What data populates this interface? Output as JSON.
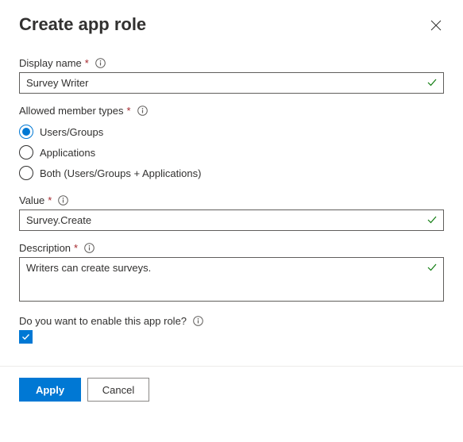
{
  "title": "Create app role",
  "fields": {
    "displayName": {
      "label": "Display name",
      "required": true,
      "value": "Survey Writer",
      "valid": true
    },
    "allowedMemberTypes": {
      "label": "Allowed member types",
      "required": true,
      "selected": "users",
      "options": [
        {
          "id": "users",
          "label": "Users/Groups"
        },
        {
          "id": "apps",
          "label": "Applications"
        },
        {
          "id": "both",
          "label": "Both (Users/Groups + Applications)"
        }
      ]
    },
    "value": {
      "label": "Value",
      "required": true,
      "value": "Survey.Create",
      "valid": true
    },
    "description": {
      "label": "Description",
      "required": true,
      "value": "Writers can create surveys.",
      "valid": true
    },
    "enable": {
      "label": "Do you want to enable this app role?",
      "checked": true
    }
  },
  "buttons": {
    "apply": "Apply",
    "cancel": "Cancel"
  }
}
